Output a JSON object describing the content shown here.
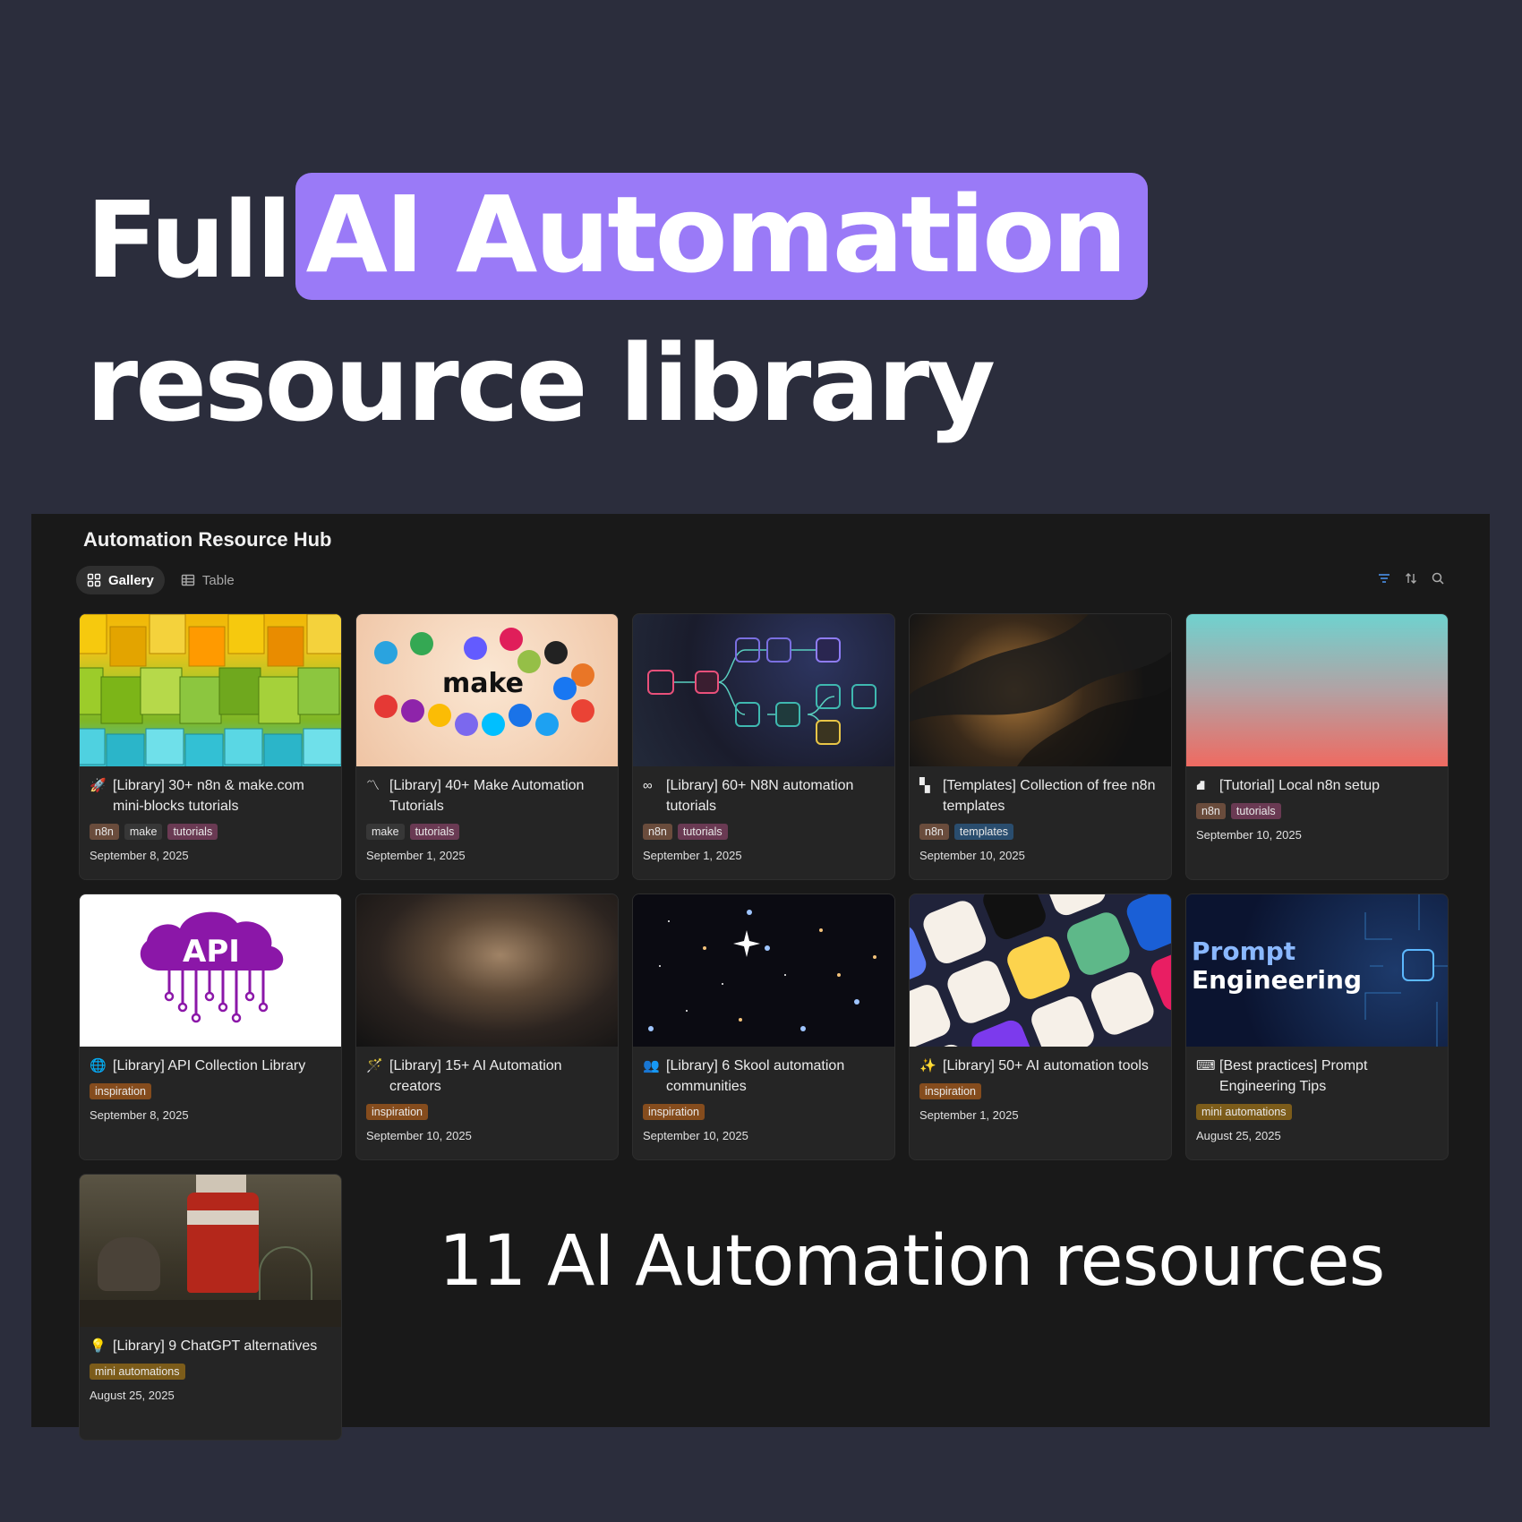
{
  "headline": {
    "prefix": "Full",
    "highlight": "AI Automation",
    "line2": "resource library"
  },
  "app": {
    "title": "Automation Resource Hub",
    "tabs": [
      {
        "label": "Gallery",
        "icon": "gallery-icon",
        "active": true
      },
      {
        "label": "Table",
        "icon": "table-icon",
        "active": false
      }
    ],
    "toolbar": [
      "filter-icon",
      "sort-icon",
      "search-icon"
    ]
  },
  "cards": [
    {
      "emoji": "🚀",
      "title": "[Library] 30+ n8n & make.com mini-blocks tutorials",
      "tags": [
        "n8n",
        "make",
        "tutorials"
      ],
      "date": "September 8, 2025",
      "cover": "lego-blocks"
    },
    {
      "emoji": "〽",
      "title": "[Library] 40+ Make Automation Tutorials",
      "tags": [
        "make",
        "tutorials"
      ],
      "date": "September 1, 2025",
      "cover": "make-logos",
      "cover_text": "make"
    },
    {
      "emoji": "∞",
      "title": "[Library] 60+ N8N automation tutorials",
      "tags": [
        "n8n",
        "tutorials"
      ],
      "date": "September 1, 2025",
      "cover": "workflow-nodes"
    },
    {
      "emoji": "▚",
      "title": "[Templates] Collection of free n8n templates",
      "tags": [
        "n8n",
        "templates"
      ],
      "date": "September 10, 2025",
      "cover": "city-night"
    },
    {
      "emoji": "⛘",
      "title": "[Tutorial] Local n8n setup",
      "tags": [
        "n8n",
        "tutorials"
      ],
      "date": "September 10, 2025",
      "cover": "gradient"
    },
    {
      "emoji": "🌐",
      "title": "[Library] API Collection Library",
      "tags": [
        "inspiration"
      ],
      "date": "September 8, 2025",
      "cover": "api-cloud",
      "cover_text": "API"
    },
    {
      "emoji": "🪄",
      "title": "[Library] 15+ AI Automation creators",
      "tags": [
        "inspiration"
      ],
      "date": "September 10, 2025",
      "cover": "nebula"
    },
    {
      "emoji": "👥",
      "title": "[Library] 6 Skool automation communities",
      "tags": [
        "inspiration"
      ],
      "date": "September 10, 2025",
      "cover": "galaxies"
    },
    {
      "emoji": "✨",
      "title": "[Library] 50+ AI automation tools",
      "tags": [
        "inspiration"
      ],
      "date": "September 1, 2025",
      "cover": "app-icons"
    },
    {
      "emoji": "⌨",
      "title": "[Best practices] Prompt Engineering Tips",
      "tags": [
        "mini automations"
      ],
      "date": "August 25, 2025",
      "cover": "prompt-engineering",
      "cover_text": "Prompt Engineering"
    },
    {
      "emoji": "💡",
      "title": "[Library] 9 ChatGPT alternatives",
      "tags": [
        "mini automations"
      ],
      "date": "August 25, 2025",
      "cover": "painting"
    }
  ],
  "summary": "11 AI Automation resources",
  "colors": {
    "background": "#2b2d3c",
    "highlight": "#9a7af7",
    "panel": "#191919",
    "card": "#252525"
  }
}
